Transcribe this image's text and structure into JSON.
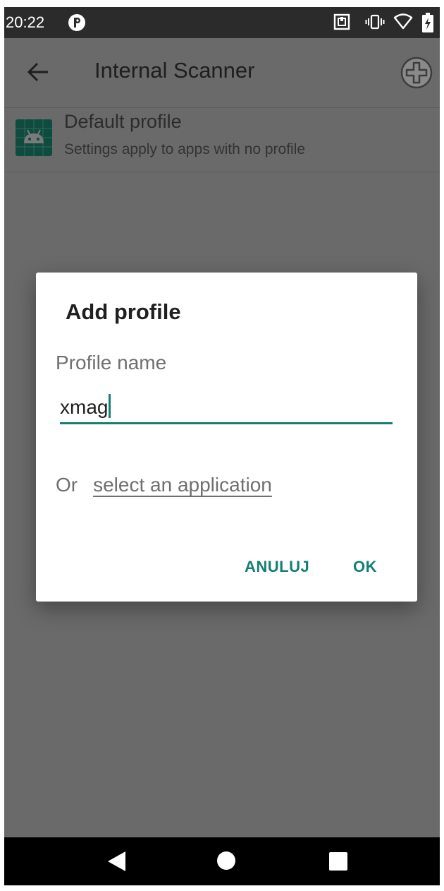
{
  "status_bar": {
    "time": "20:22",
    "icons": [
      "app-notification-icon",
      "nfc-icon",
      "vibrate-icon",
      "wifi-icon",
      "battery-charging-icon"
    ]
  },
  "app_bar": {
    "title": "Internal Scanner",
    "back_icon": "arrow-back-icon",
    "add_icon": "add-circle-icon"
  },
  "profile": {
    "title": "Default profile",
    "subtitle": "Settings apply to apps with no profile",
    "icon": "android-app-icon"
  },
  "dialog": {
    "title": "Add profile",
    "field_label": "Profile name",
    "field_value": "xmag",
    "or_text": "Or",
    "link_text": "select an application",
    "cancel_label": "ANULUJ",
    "ok_label": "OK"
  },
  "nav_bar": {
    "icons": [
      "nav-back-icon",
      "nav-home-icon",
      "nav-recents-icon"
    ]
  },
  "colors": {
    "accent": "#137f75",
    "scrim": "#6a6a6a",
    "status_bar": "#2b2b2b"
  }
}
